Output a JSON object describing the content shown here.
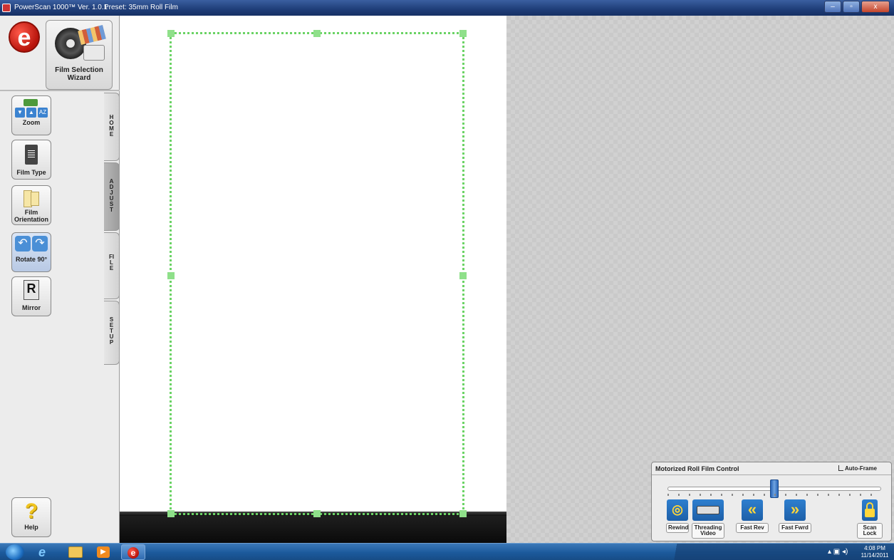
{
  "window": {
    "title": "PowerScan 1000™ Ver. 1.0.1",
    "preset": "Preset: 35mm Roll Film",
    "controls": {
      "minimize": "–",
      "maximize": "▫",
      "close": "x"
    }
  },
  "left_panel": {
    "wizard_label": "Film Selection Wizard",
    "tools": [
      {
        "label": "Zoom"
      },
      {
        "label": "Film Type"
      },
      {
        "label": "Film Orientation"
      },
      {
        "label": "Rotate 90°"
      },
      {
        "label": "Mirror"
      }
    ],
    "help_label": "Help",
    "tabs": [
      {
        "label": "HOME"
      },
      {
        "label": "ADJUST"
      },
      {
        "label": "FILE"
      },
      {
        "label": "SETUP"
      }
    ],
    "active_tab": "ADJUST"
  },
  "roll_film_control": {
    "title": "Motorized Roll Film Control",
    "auto_frame_label": "Auto-Frame",
    "slider_position_pct": 50,
    "buttons": [
      {
        "label": "Rewind"
      },
      {
        "label": "Threading Video"
      },
      {
        "label": "Fast Rev"
      },
      {
        "label": "Fast Fwrd"
      },
      {
        "label": "Scan Lock"
      }
    ]
  },
  "taskbar": {
    "time": "4:08 PM",
    "date": "11/14/2011"
  },
  "colors": {
    "crop_border": "#6bd365",
    "titlebar": "#1f3d78",
    "taskbar": "#1c5a9c"
  }
}
